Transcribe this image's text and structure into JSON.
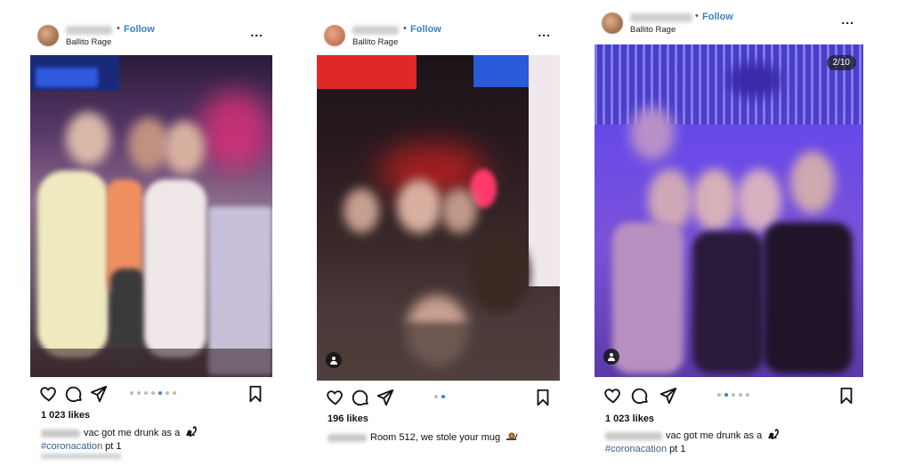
{
  "posts": [
    {
      "follow_label": "Follow",
      "separator": "•",
      "location": "Ballito Rage",
      "more_label": "...",
      "likes": "1 023 likes",
      "caption_text": "vac got me drunk as a",
      "hashtag": "#coronacation",
      "caption_suffix": " pt 1",
      "carousel_dots": 7,
      "carousel_active": 5
    },
    {
      "follow_label": "Follow",
      "separator": "•",
      "location": "Ballito Rage",
      "more_label": "...",
      "likes": "196 likes",
      "caption_text": "Room 512, we stole your mug",
      "carousel_dots": 2,
      "carousel_active": 2
    },
    {
      "follow_label": "Follow",
      "separator": "•",
      "location": "Ballito Rage",
      "more_label": "...",
      "likes": "1 023 likes",
      "caption_text": "vac got me drunk as a",
      "hashtag": "#coronacation",
      "caption_suffix": " pt 1",
      "image_counter": "2/10",
      "carousel_dots": 5,
      "carousel_active": 2
    }
  ],
  "colors": {
    "follow": "#3b82c4",
    "dot_active": "#3b82c4",
    "dot_inactive": "#bcbcbc"
  },
  "icons": [
    "heart-icon",
    "comment-icon",
    "share-icon",
    "bookmark-icon",
    "more-icon",
    "user-tag-icon"
  ]
}
